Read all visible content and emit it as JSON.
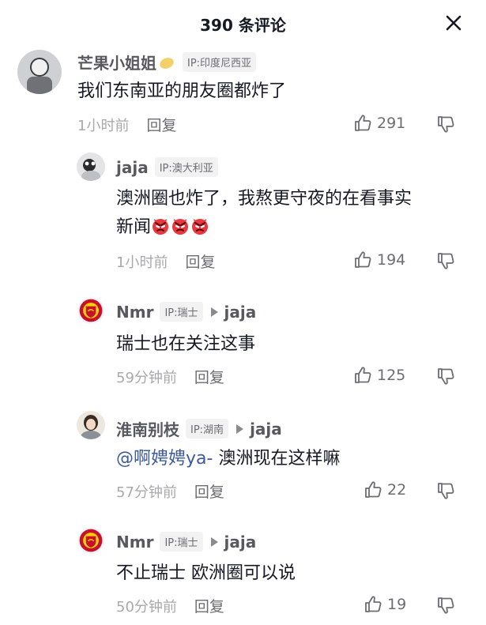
{
  "header": {
    "title": "390 条评论",
    "close_icon": "close-icon"
  },
  "comments": [
    {
      "user": "芒果小姐姐",
      "ip": "IP:印度尼西亚",
      "content": "我们东南亚的朋友圈都炸了",
      "time": "1小时前",
      "reply_label": "回复",
      "likes": "291"
    },
    {
      "user": "jaja",
      "ip": "IP:澳大利亚",
      "content_line1": "澳洲圈也炸了，我熬更守夜的在看事实",
      "content_line2": "新闻",
      "emoji": "angry-face-icon",
      "time": "1小时前",
      "reply_label": "回复",
      "likes": "194"
    },
    {
      "user": "Nmr",
      "ip": "IP:瑞士",
      "reply_to": "jaja",
      "content": "瑞士也在关注这事",
      "time": "59分钟前",
      "reply_label": "回复",
      "likes": "125"
    },
    {
      "user": "淮南别枝",
      "ip": "IP:湖南",
      "reply_to": "jaja",
      "mention": "@啊娉娉ya-",
      "content": " 澳洲现在这样嘛",
      "time": "57分钟前",
      "reply_label": "回复",
      "likes": "22"
    },
    {
      "user": "Nmr",
      "ip": "IP:瑞士",
      "reply_to": "jaja",
      "content": "不止瑞士 欧洲圈可以说",
      "time": "50分钟前",
      "reply_label": "回复",
      "likes": "19"
    }
  ],
  "colors": {
    "text": "#161823",
    "username": "#57595f",
    "meta": "#a8a9ad",
    "accent": "#c8102e"
  }
}
